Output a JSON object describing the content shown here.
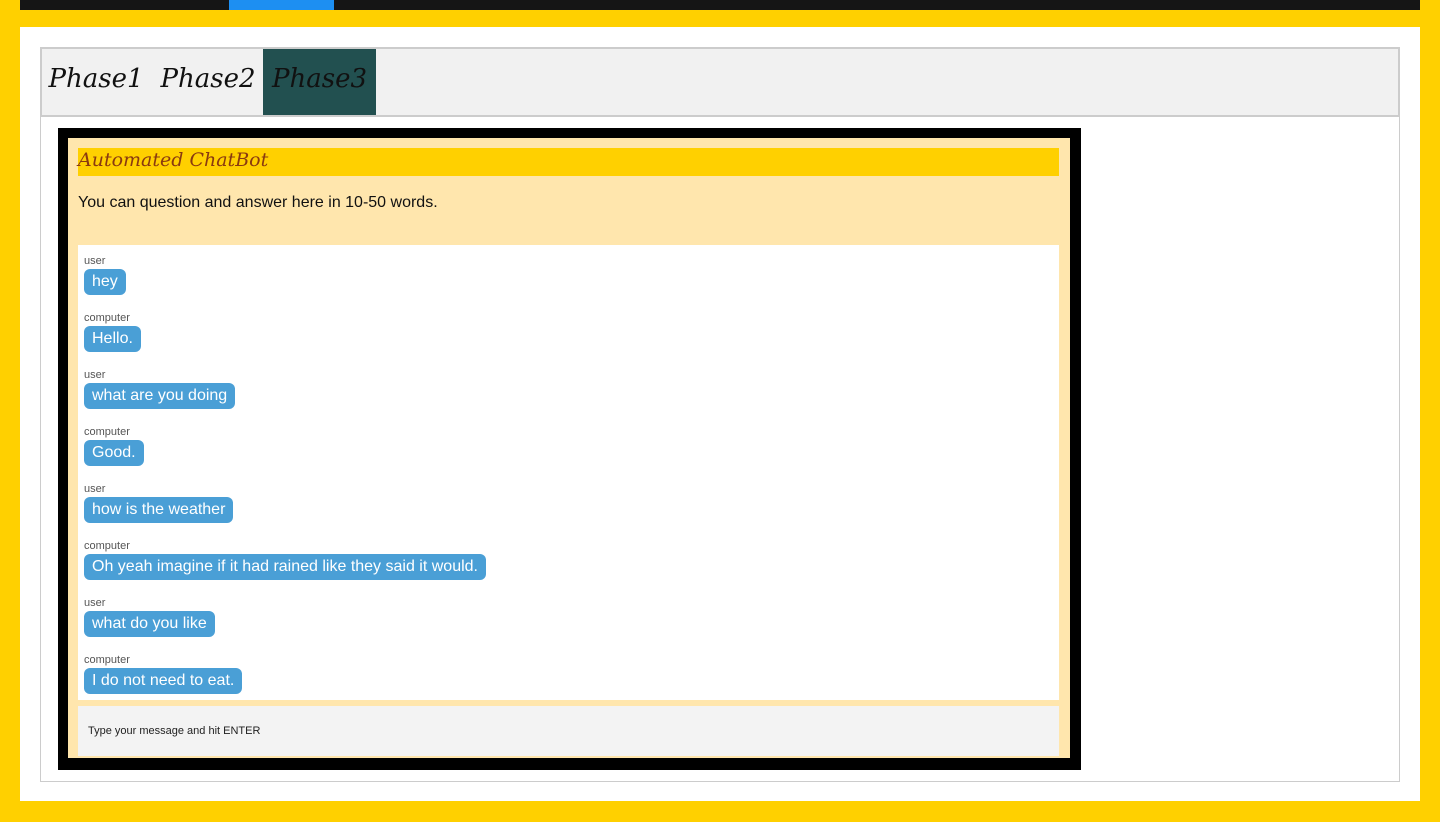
{
  "tabs": [
    {
      "label": "Phase1",
      "active": false
    },
    {
      "label": "Phase2",
      "active": false
    },
    {
      "label": "Phase3",
      "active": true
    }
  ],
  "chat": {
    "title": "Automated ChatBot",
    "description": "You can question and answer here in 10-50 words.",
    "messages": [
      {
        "author": "user",
        "text": "hey"
      },
      {
        "author": "computer",
        "text": "Hello."
      },
      {
        "author": "user",
        "text": "what are you doing"
      },
      {
        "author": "computer",
        "text": "Good."
      },
      {
        "author": "user",
        "text": "how is the weather"
      },
      {
        "author": "computer",
        "text": "Oh yeah imagine if it had rained like they said it would."
      },
      {
        "author": "user",
        "text": "what do you like"
      },
      {
        "author": "computer",
        "text": "I do not need to eat."
      }
    ],
    "input_placeholder": "Type your message and hit ENTER"
  },
  "colors": {
    "page_background": "#ffd000",
    "active_tab": "#225050",
    "bubble": "#4a9fd6",
    "chat_panel": "#ffe6ad",
    "progress_bar": "#1d8ff2"
  }
}
